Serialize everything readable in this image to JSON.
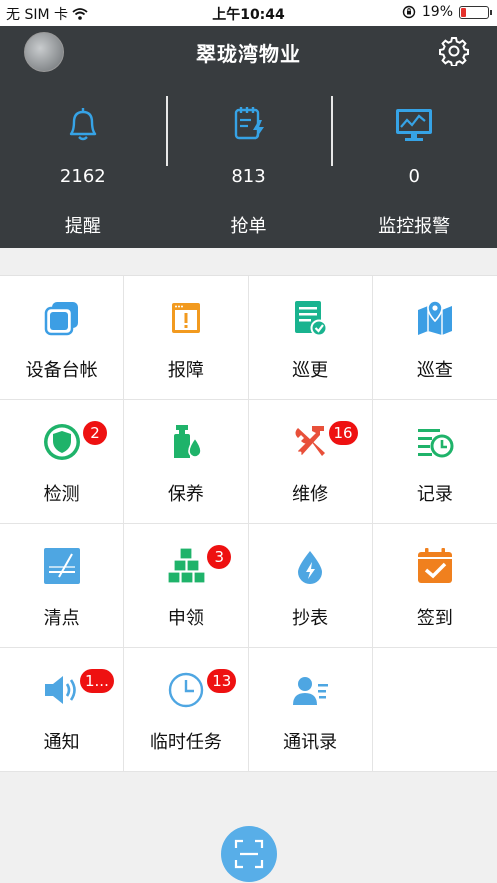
{
  "status_bar": {
    "carrier": "无 SIM 卡",
    "time": "上午10:44",
    "battery_percent": "19%",
    "battery_level": 0.19
  },
  "header": {
    "title": "翠珑湾物业",
    "stats": [
      {
        "count": "2162",
        "label": "提醒",
        "icon": "bell-icon"
      },
      {
        "count": "813",
        "label": "抢单",
        "icon": "task-clipboard-icon"
      },
      {
        "count": "0",
        "label": "监控报警",
        "icon": "monitor-icon"
      }
    ]
  },
  "grid": {
    "items": [
      {
        "label": "设备台帐",
        "icon": "device-ledger-icon",
        "badge": ""
      },
      {
        "label": "报障",
        "icon": "fault-report-icon",
        "badge": ""
      },
      {
        "label": "巡更",
        "icon": "patrol-icon",
        "badge": ""
      },
      {
        "label": "巡查",
        "icon": "map-inspect-icon",
        "badge": ""
      },
      {
        "label": "检测",
        "icon": "shield-icon",
        "badge": "2"
      },
      {
        "label": "保养",
        "icon": "maintenance-bottle-icon",
        "badge": ""
      },
      {
        "label": "维修",
        "icon": "repair-tools-icon",
        "badge": "16"
      },
      {
        "label": "记录",
        "icon": "record-clock-icon",
        "badge": ""
      },
      {
        "label": "清点",
        "icon": "inventory-icon",
        "badge": ""
      },
      {
        "label": "申领",
        "icon": "boxes-icon",
        "badge": "3"
      },
      {
        "label": "抄表",
        "icon": "water-drop-icon",
        "badge": ""
      },
      {
        "label": "签到",
        "icon": "calendar-check-icon",
        "badge": ""
      },
      {
        "label": "通知",
        "icon": "speaker-icon",
        "badge": "1..."
      },
      {
        "label": "临时任务",
        "icon": "clock-icon",
        "badge": "13"
      },
      {
        "label": "通讯录",
        "icon": "contacts-icon",
        "badge": ""
      }
    ]
  },
  "colors": {
    "header_bg": "#383c3f",
    "badge": "#ee1111",
    "scan_button": "#58aee8"
  }
}
